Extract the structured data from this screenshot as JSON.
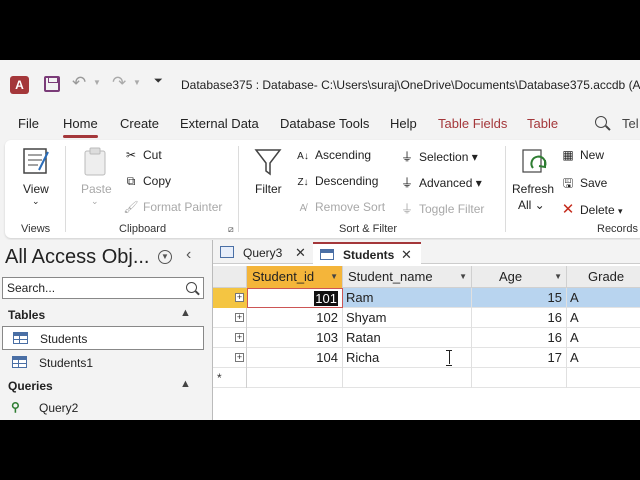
{
  "window": {
    "title": "Database375 : Database- C:\\Users\\suraj\\OneDrive\\Documents\\Database375.accdb (Ac",
    "app_logo_letter": "A"
  },
  "qat": {
    "undo": "↶",
    "redo": "↷",
    "customize": "⏷"
  },
  "menu": {
    "tabs": [
      "File",
      "Home",
      "Create",
      "External Data",
      "Database Tools",
      "Help",
      "Table Fields",
      "Table"
    ],
    "active": "Home",
    "tell": "Tel"
  },
  "ribbon": {
    "views": {
      "view_label": "View",
      "group": "Views"
    },
    "clipboard": {
      "paste": "Paste",
      "cut": "Cut",
      "copy": "Copy",
      "format_painter": "Format Painter",
      "group": "Clipboard"
    },
    "sort_filter": {
      "filter": "Filter",
      "ascending": "Ascending",
      "descending": "Descending",
      "remove_sort": "Remove Sort",
      "selection": "Selection",
      "advanced": "Advanced",
      "toggle_filter": "Toggle Filter",
      "group": "Sort & Filter"
    },
    "records": {
      "refresh": "Refresh",
      "refresh_all": "All",
      "new": "New",
      "save": "Save",
      "delete": "Delete",
      "group": "Records"
    }
  },
  "nav": {
    "title": "All Access Obj...",
    "search_placeholder": "Search...",
    "sections": [
      {
        "label": "Tables",
        "items": [
          "Students",
          "Students1"
        ]
      },
      {
        "label": "Queries",
        "items": [
          "Query2"
        ]
      }
    ],
    "selected": "Students"
  },
  "doc_tabs": [
    {
      "label": "Query3",
      "active": false
    },
    {
      "label": "Students",
      "active": true
    }
  ],
  "table": {
    "columns": [
      "Student_id",
      "Student_name",
      "Age",
      "Grade"
    ],
    "rows": [
      {
        "Student_id": "101",
        "Student_name": "Ram",
        "Age": "15",
        "Grade": "A"
      },
      {
        "Student_id": "102",
        "Student_name": "Shyam",
        "Age": "16",
        "Grade": "A"
      },
      {
        "Student_id": "103",
        "Student_name": "Ratan",
        "Age": "16",
        "Grade": "A"
      },
      {
        "Student_id": "104",
        "Student_name": "Richa",
        "Age": "17",
        "Grade": "A"
      }
    ],
    "new_row_marker": "*"
  },
  "colors": {
    "accent": "#a4373a",
    "selected_row": "#b8d4ef",
    "active_header": "#f4b53a"
  }
}
